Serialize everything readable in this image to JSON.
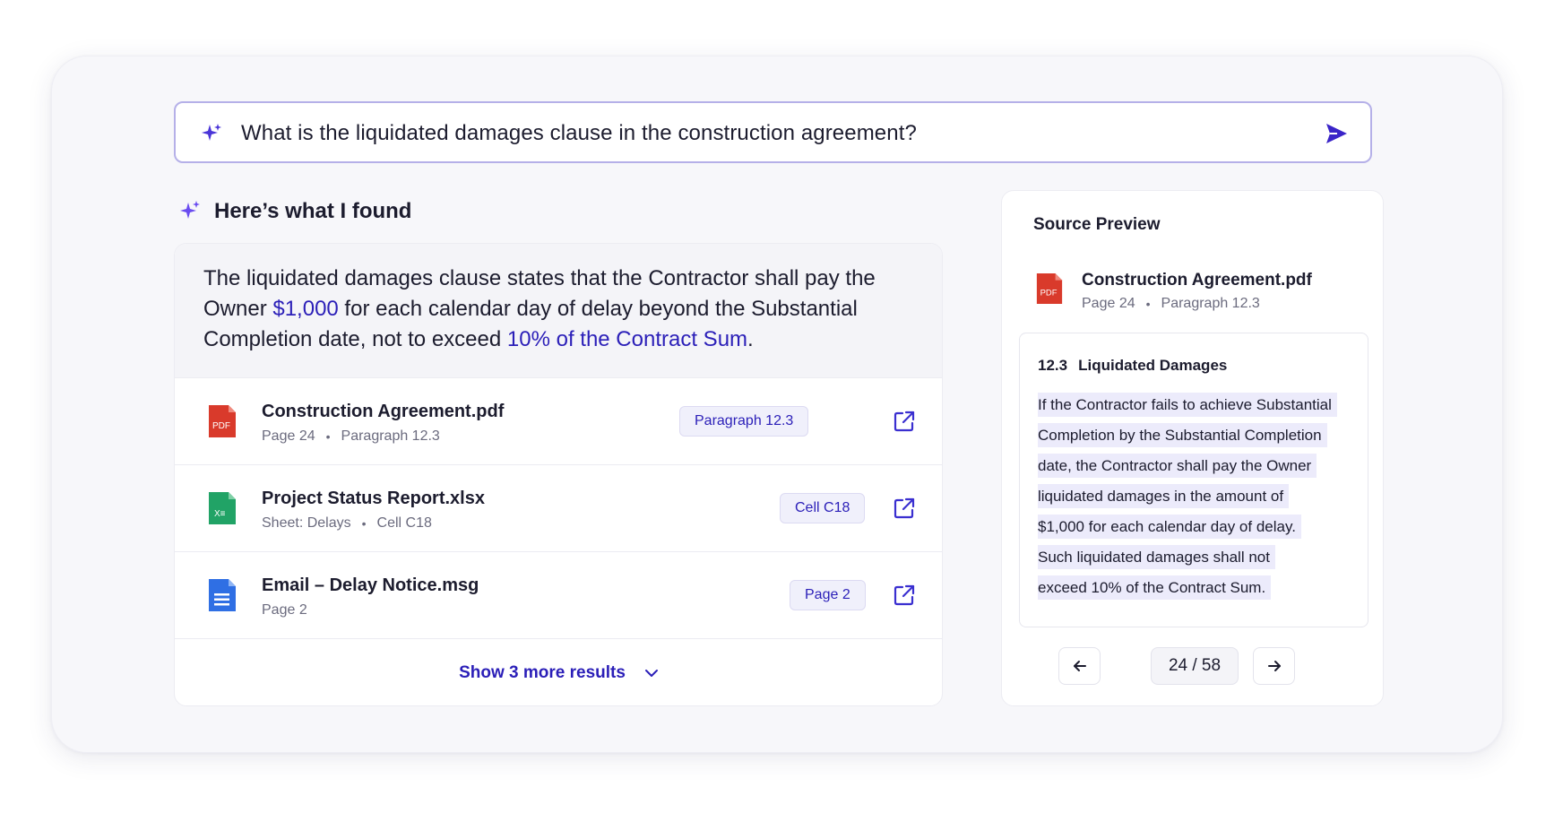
{
  "search": {
    "query": "What is the liquidated damages clause in the construction agreement?"
  },
  "answer": {
    "heading": "Here’s what I found",
    "text_1": "The liquidated damages clause states that the Contractor shall pay the Owner ",
    "highlight_1": "$1,000",
    "text_2": " for each calendar day of delay beyond the Substantial Completion date, not to exceed ",
    "highlight_2": "10% of the Contract Sum",
    "text_3": "."
  },
  "results": [
    {
      "name": "Construction Agreement.pdf",
      "meta_1": "Page 24",
      "meta_2": "Paragraph 12.3",
      "badge": "Paragraph 12.3",
      "icon": "pdf-file-icon",
      "icon_label": "PDF"
    },
    {
      "name": "Project Status Report.xlsx",
      "meta_1": "Sheet: Delays",
      "meta_2": "Cell C18",
      "badge": "Cell C18",
      "icon": "excel-file-icon",
      "icon_label": "X≡"
    },
    {
      "name": "Email – Delay Notice.msg",
      "meta_1": "Page 2",
      "badge": "Page 2",
      "icon": "document-file-icon"
    }
  ],
  "show_more": "Show 3 more results",
  "preview": {
    "title": "Source Preview",
    "file_name": "Construction Agreement.pdf",
    "meta_1": "Page 24",
    "meta_2": "Paragraph 12.3",
    "section_number": "12.3",
    "section_title": "Liquidated Damages",
    "lines": [
      "If the Contractor fails to achieve Substantial",
      "Completion by the Substantial Completion",
      "date, the Contractor shall pay the Owner",
      "liquidated damages in the amount of",
      "$1,000 for each calendar day of delay.",
      "Such liquidated damages shall not",
      "exceed 10% of the Contract Sum."
    ],
    "page_counter": "24 / 58"
  },
  "colors": {
    "accent": "#2b1fb8",
    "sparkle": "#6a4cf0",
    "pdf": "#d93a2b",
    "excel": "#21a366",
    "doc": "#2f6fe4",
    "highlight_bg": "#ecebfb"
  }
}
